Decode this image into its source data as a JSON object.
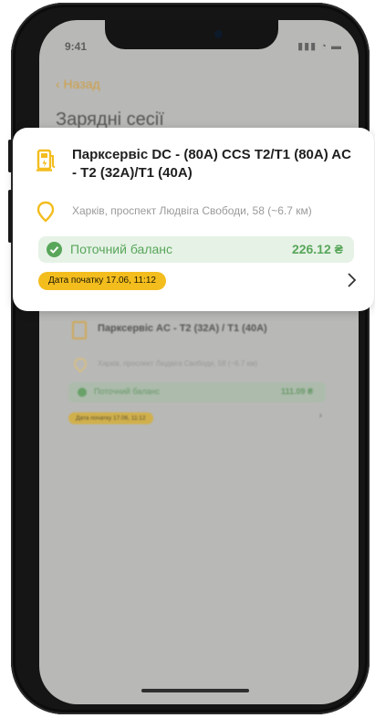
{
  "status_bar": {
    "time": "9:41",
    "icons": "▮▮▮ ◔ ▬"
  },
  "nav": {
    "back_label": "‹ Назад",
    "page_title": "Зарядні сесії"
  },
  "active_session": {
    "station_name": "Парксервіс DC - (80A) CCS T2/T1 (80A) AC - T2 (32A)/T1 (40A)",
    "address": "Харків, проспект Людвіга Свободи, 58 (~6.7 км)",
    "balance_label": "Поточний баланс",
    "balance_value": "226.12 ₴",
    "start_date": "Дата початку 17.06, 11:12"
  },
  "background_session": {
    "station_name": "Парксервіс AC - T2 (32A) / T1 (40A)",
    "address": "Харків, проспект Людвіга Свободи, 58 (~6.7 км)",
    "balance_label": "Поточний баланс",
    "balance_value": "111.09 ₴",
    "start_date": "Дата початку 17.06, 11:12"
  },
  "icons": {
    "station": "charging-station-icon",
    "location": "location-pin-icon",
    "balance": "check-circle-icon",
    "open": "chevron-right-icon"
  },
  "colors": {
    "accent_yellow": "#f3bd1e",
    "balance_green": "#58a65a",
    "balance_bg": "#e6f2e6",
    "back_orange": "#d49a2a"
  }
}
